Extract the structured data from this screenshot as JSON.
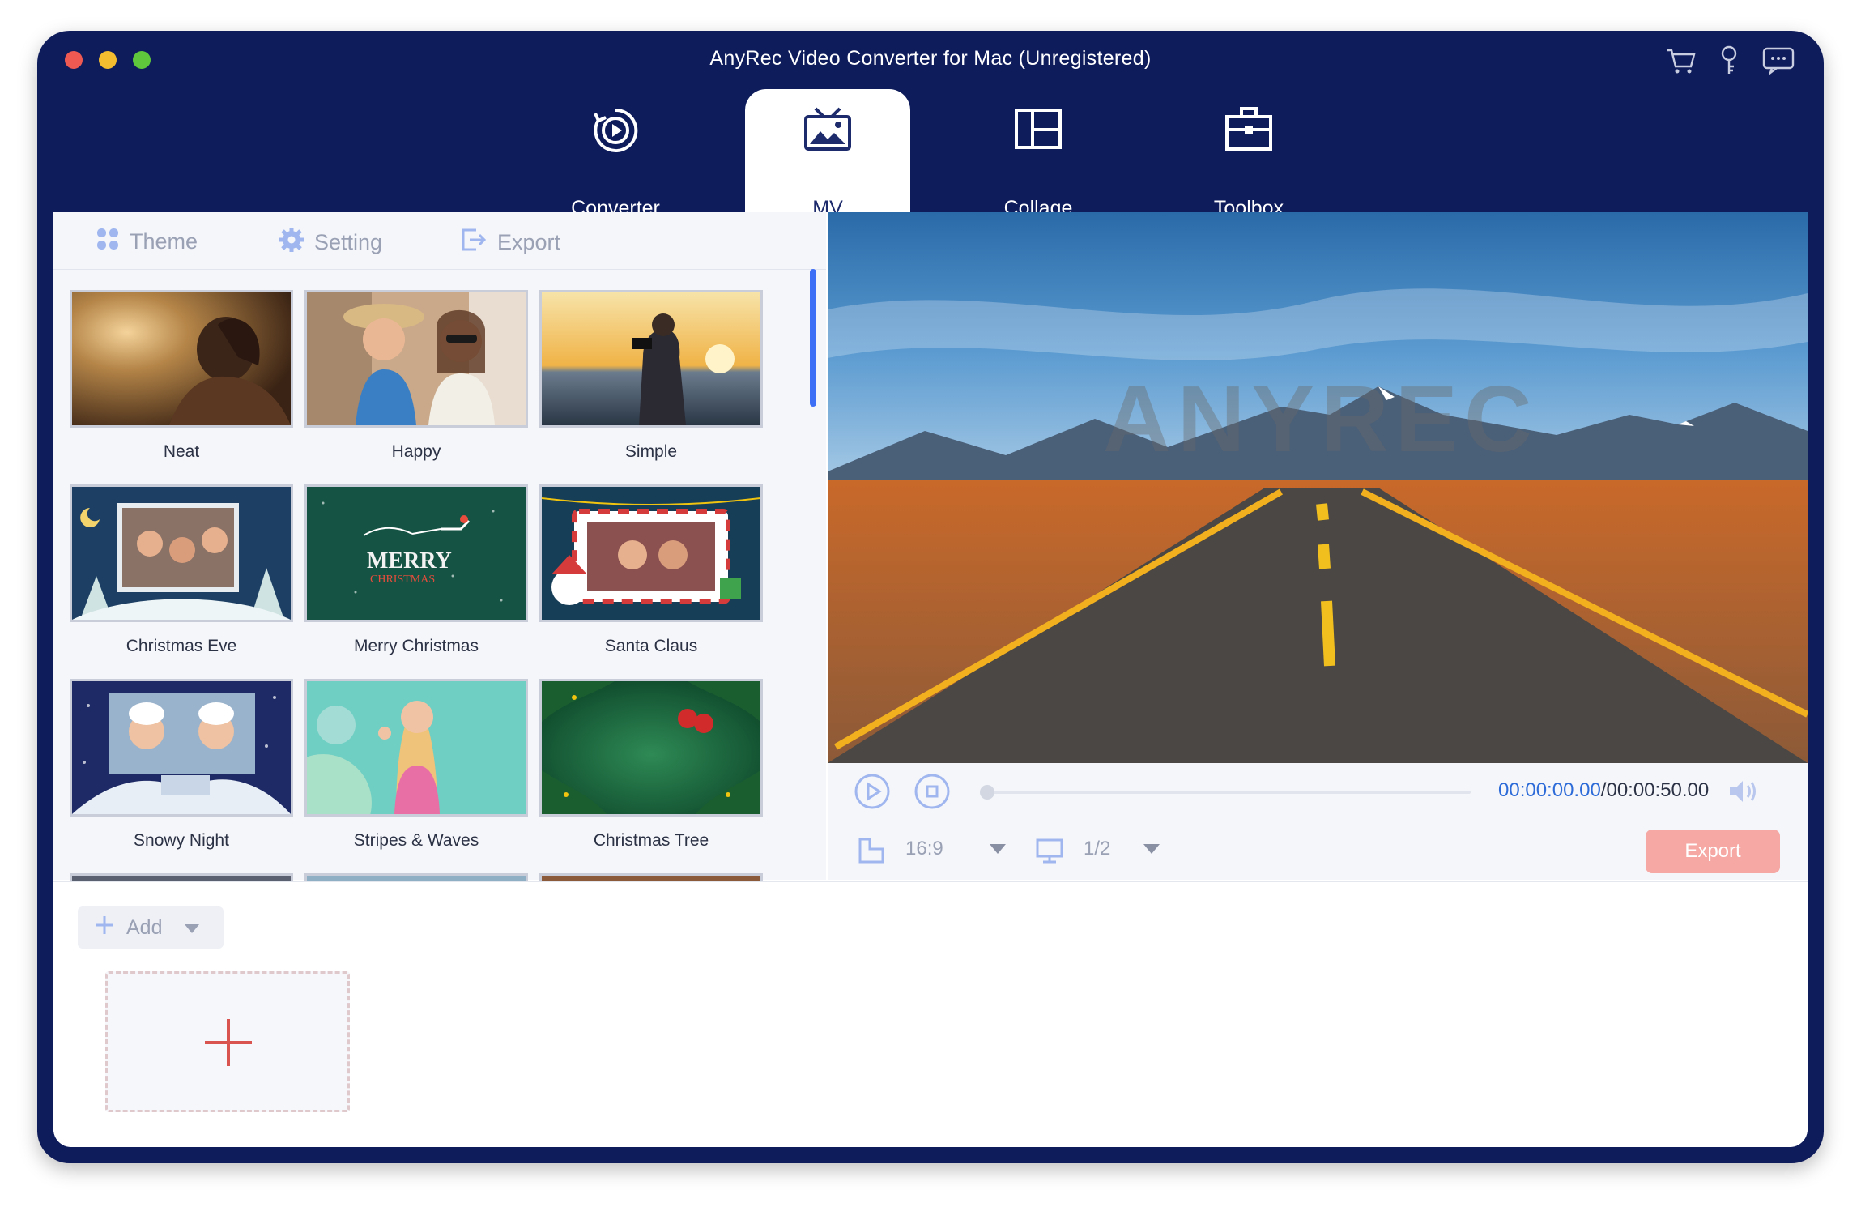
{
  "window": {
    "title": "AnyRec Video Converter for Mac (Unregistered)"
  },
  "title_icons": [
    "cart-icon",
    "key-icon",
    "feedback-icon"
  ],
  "nav": {
    "tabs": [
      {
        "label": "Converter",
        "icon": "converter-icon",
        "active": false
      },
      {
        "label": "MV",
        "icon": "mv-icon",
        "active": true
      },
      {
        "label": "Collage",
        "icon": "collage-icon",
        "active": false
      },
      {
        "label": "Toolbox",
        "icon": "toolbox-icon",
        "active": false
      }
    ]
  },
  "subtabs": {
    "theme": "Theme",
    "setting": "Setting",
    "export": "Export"
  },
  "themes": [
    {
      "label": "Neat"
    },
    {
      "label": "Happy"
    },
    {
      "label": "Simple"
    },
    {
      "label": "Christmas Eve"
    },
    {
      "label": "Merry Christmas"
    },
    {
      "label": "Santa Claus"
    },
    {
      "label": "Snowy Night"
    },
    {
      "label": "Stripes & Waves"
    },
    {
      "label": "Christmas Tree"
    }
  ],
  "thumb_text": {
    "merry": "MERRY",
    "christmas": "CHRISTMAS"
  },
  "preview": {
    "watermark": "ANYREC"
  },
  "player": {
    "current_time": "00:00:00.00",
    "total_time": "/00:00:50.00",
    "progress": 0,
    "aspect_ratio": "16:9",
    "resolution": "1/2",
    "export_label": "Export"
  },
  "bottom": {
    "add_label": "Add"
  },
  "colors": {
    "navy": "#0f1c5c",
    "accent_blue": "#2d6bd8",
    "export_pink": "#f5a8a4",
    "add_red": "#d9534f"
  }
}
